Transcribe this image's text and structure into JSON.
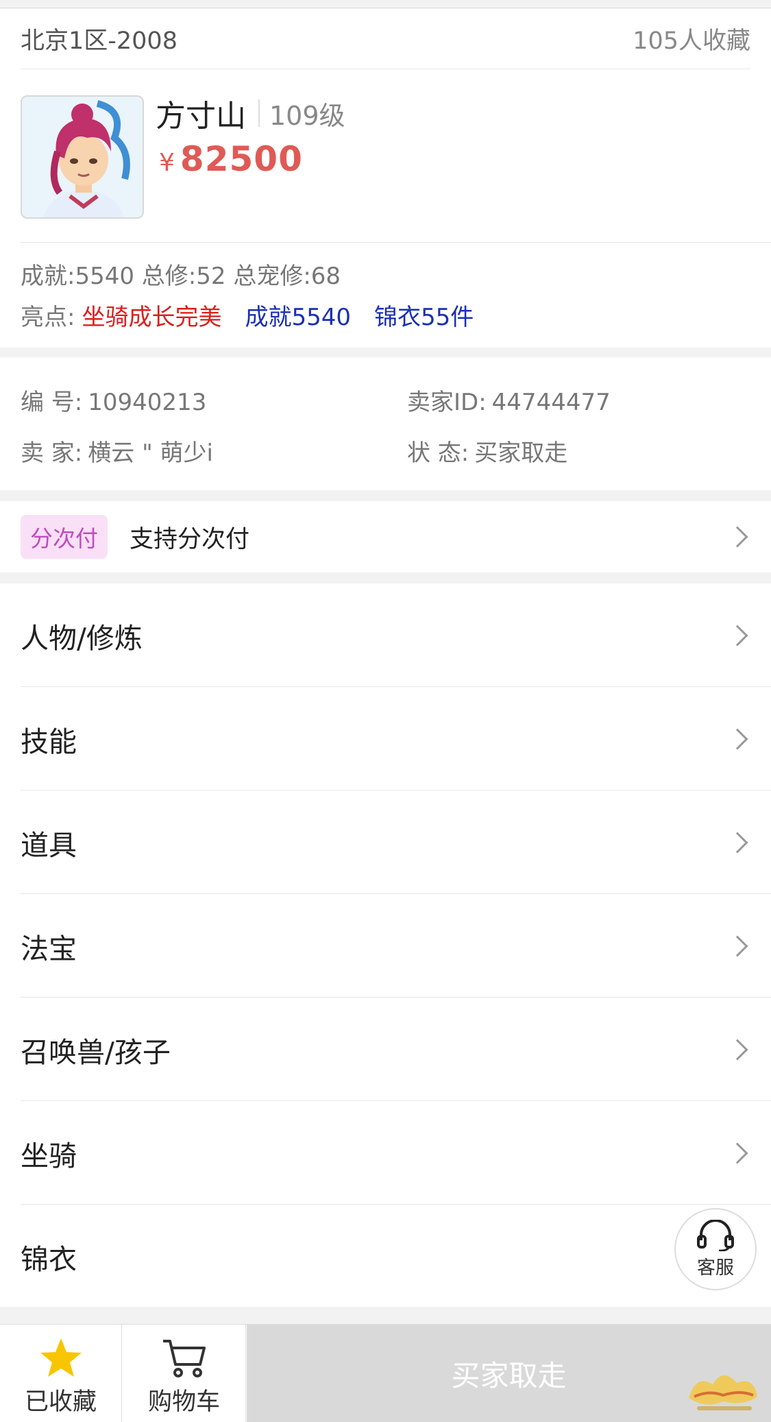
{
  "header": {
    "server": "北京1区-2008",
    "favorites": "105人收藏"
  },
  "character": {
    "school": "方寸山",
    "level": "109级",
    "price_symbol": "¥",
    "price": "82500"
  },
  "stats": "成就:5540 总修:52 总宠修:68",
  "highlights": {
    "label": "亮点:",
    "items": [
      "坐骑成长完美",
      "成就5540",
      "锦衣55件"
    ]
  },
  "info": {
    "number_label": "编 号:",
    "number_value": "10940213",
    "seller_id_label": "卖家ID:",
    "seller_id_value": "44744477",
    "seller_label": "卖 家:",
    "seller_value": "横云 \" 萌少i",
    "status_label": "状 态:",
    "status_value": "买家取走"
  },
  "installment": {
    "badge": "分次付",
    "text": "支持分次付"
  },
  "menu": [
    {
      "label": "人物/修炼"
    },
    {
      "label": "技能"
    },
    {
      "label": "道具"
    },
    {
      "label": "法宝"
    },
    {
      "label": "召唤兽/孩子"
    },
    {
      "label": "坐骑"
    },
    {
      "label": "锦衣"
    }
  ],
  "customer_service": {
    "label": "客服"
  },
  "bottom_bar": {
    "favorite_label": "已收藏",
    "cart_label": "购物车",
    "action_label": "买家取走"
  },
  "colors": {
    "price": "#e05a55",
    "highlight_red": "#d9201d",
    "highlight_blue": "#1a2fb5",
    "badge_bg": "#f9e0f6",
    "badge_text": "#c04cc0",
    "star": "#f7c600",
    "action_disabled": "#d9d9d9"
  },
  "icons": {
    "favorite": "star-icon",
    "cart": "cart-icon",
    "customer_service": "headset-icon",
    "chevron": "chevron-right-icon"
  }
}
